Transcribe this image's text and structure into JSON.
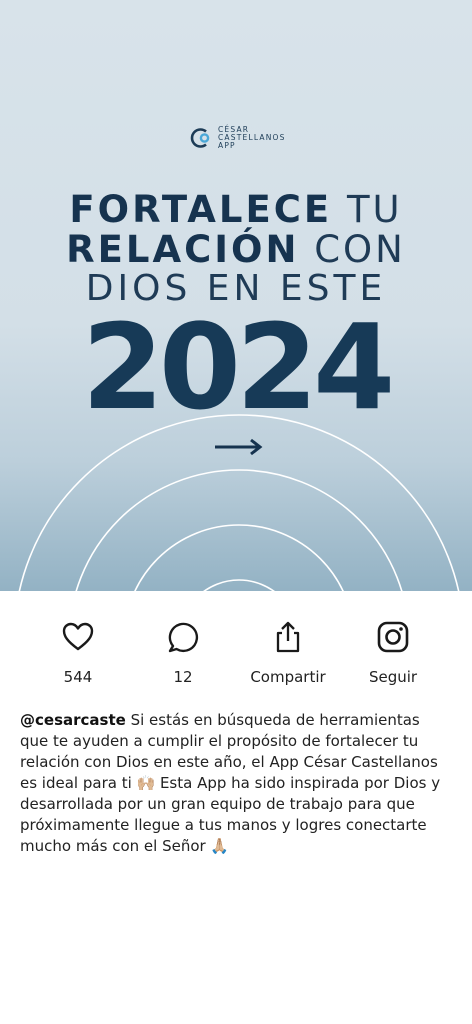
{
  "post": {
    "logo_text_1": "CÉSAR",
    "logo_text_2": "CASTELLANOS",
    "logo_text_3": "APP",
    "headline_line1_bold": "FORTALECE",
    "headline_line1_light": "TU",
    "headline_line2_bold": "RELACIÓN",
    "headline_line2_light": "CON",
    "headline_line3": "DIOS EN ESTE",
    "year": "2024",
    "colors": {
      "navy": "#16334f",
      "sky": "#d8e3ea",
      "horizon": "#93b2c4"
    }
  },
  "actions": {
    "like_icon": "heart-icon",
    "like_count": "544",
    "comment_icon": "comment-bubble-icon",
    "comment_count": "12",
    "share_icon": "share-icon",
    "share_label": "Compartir",
    "follow_icon": "instagram-icon",
    "follow_label": "Seguir"
  },
  "caption": {
    "username": "@cesarcaste",
    "text": " Si estás en búsqueda de herramientas que te ayuden a cumplir el propósito de fortalecer tu relación con Dios en este año, el App César Castellanos es ideal para ti 🙌🏼  Esta App ha sido inspirada por Dios y desarrollada por un gran equipo de trabajo para que próximamente llegue a tus manos y logres conectarte mucho más con el Señor 🙏🏼"
  }
}
